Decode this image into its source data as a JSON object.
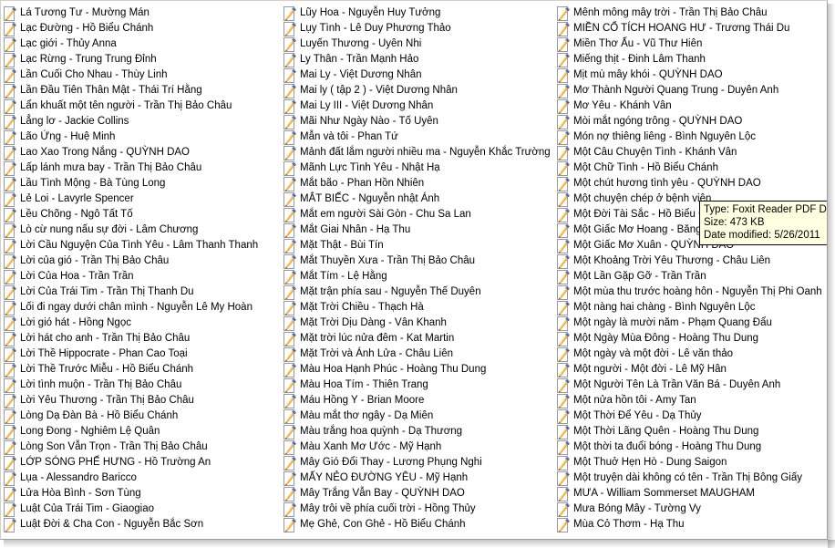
{
  "window": {
    "kind": "file-explorer-list-view",
    "icon_name": "pdf-document-icon",
    "accent": "#ffffe1",
    "border_color": "#9e9e9e",
    "text_color": "#000000"
  },
  "tooltip": {
    "visible": true,
    "type_line": "Type: Foxit Reader PDF Do",
    "size_line": "Size: 473 KB",
    "date_line": "Date modified: 5/26/2011 ",
    "background": "#ffffe1"
  },
  "columns": [
    {
      "name": "column-1",
      "items": [
        "Lá Tương Tư - Mường Mán",
        "Lạc Đường - Hồ Biểu Chánh",
        "Lạc giới - Thủy Anna",
        "Lạc Rừng - Trung Trung Đỉnh",
        "Lần Cuối Cho Nhau - Thùy Linh",
        "Lần Đầu Tiên Thân Mật - Thái Trí Hằng",
        "Lẩn khuất một tên người - Trần Thị Bảo Châu",
        "Lẳng lơ - Jackie Collins",
        "Lão Ứng - Huệ Minh",
        "Lao Xao Trong Nắng - QUỲNH DAO",
        "Lấp lánh mưa bay - Trần Thị Bảo Châu",
        "Lầu Tình Mộng - Bà Tùng Long",
        "Lẻ Loi - Lavyrle Spencer",
        "Lều Chõng - Ngô Tất Tố",
        "Lò cừ nung nấu sự đời - Lâm Chương",
        "Lời Cầu Nguyện Của Tình Yêu - Lâm Thanh Thanh",
        "Lời của gió - Trần Thị Bảo Châu",
        "Lời Của Hoa - Trần Trần",
        "Lời Của Trái Tim - Trần Thị Thanh Du",
        "Lối đi ngay dưới chân mình - Nguyễn Lê My Hoàn",
        "Lời gió hát - Hồng Ngọc",
        "Lời hát cho anh - Trần Thị Bảo Châu",
        "Lời Thề Hippocrate - Phan Cao Toại",
        "Lời Thề Trước Miễu - Hồ Biểu Chánh",
        "Lời tình muộn - Trần Thị Bảo Châu",
        "Lời Yêu Thương - Trần Thị Bảo Châu",
        "Lòng Dạ Đàn Bà - Hồ Biểu Chánh",
        "Long Đong - Nghiêm Lệ Quân",
        "Lòng Son Vẫn Trọn - Trần Thị Bảo Châu",
        "LỚP SÓNG PHẾ HƯNG - Hồ Trường An",
        "Lụa - Alessandro Baricco",
        "Lửa Hòa Bình - Sơn Tùng",
        "Luật Của Trái Tim - Giaogiao",
        "Luật Đời & Cha Con - Nguyễn Bắc Sơn"
      ]
    },
    {
      "name": "column-2",
      "items": [
        "Lũy Hoa - Nguyễn Huy Tưởng",
        "Lụy Tình - Lê Duy Phương Thảo",
        "Luyến Thương - Uyên Nhi",
        "Ly Thân - Trần Mạnh Hảo",
        "Mai Ly - Việt Dương Nhân",
        "Mai ly ( tập 2 ) - Việt Dương Nhân",
        "Mai Ly III - Việt Dương Nhân",
        "Mãi Như Ngày Nào - Tố Uyên",
        "Mẫn và tôi - Phan Tứ",
        "Mảnh đất lắm người nhiều ma - Nguyễn Khắc Trường",
        "Mãnh Lực Tình Yêu - Nhật Hạ",
        "Mắt bão - Phan Hồn Nhiên",
        "MẮT BIẾC - Nguyễn nhật Ánh",
        "Mắt em người Sài Gòn - Chu Sa Lan",
        "Mắt Giai Nhân - Hạ Thu",
        "Mặt Thật - Bùi Tín",
        "Mắt Thuyền Xưa - Trần Thị Bảo Châu",
        "Mắt Tím - Lệ Hằng",
        "Mặt trận phía sau - Nguyễn Thế Duyên",
        "Mặt Trời Chiều - Thạch Hà",
        "Mặt Trời Dịu Dàng - Vân Khanh",
        "Mặt trời lúc nửa đêm - Kat Martin",
        "Mặt Trời và Ánh Lửa - Châu Liên",
        "Màu Hoa Hạnh Phúc - Hoàng Thu Dung",
        "Màu Hoa Tím - Thiên Trang",
        "Máu Hồng Y - Brian Moore",
        "Màu mắt thơ ngây - Dạ Miên",
        "Màu trắng hoa quỳnh - Dạ Thương",
        "Màu Xanh Mơ Ước - Mỹ Hạnh",
        "Mây Gió Đổi Thay - Lương Phụng Nghi",
        "MẤY NẺO ĐƯỜNG YÊU - Mỹ Hạnh",
        "Mây Trắng Vẫn Bay - QUỲNH DAO",
        "Mây trôi về phía cuối trời - Hồng Thủy",
        "Mẹ Ghẻ, Con Ghẻ - Hồ Biểu Chánh"
      ]
    },
    {
      "name": "column-3",
      "items": [
        "Mênh mông mây trời - Trần Thị Bảo Châu",
        "MIỀN CỔ TÍCH HOANG HƯ - Trương Thái Du",
        "Miền Thơ Ấu - Vũ Thư Hiên",
        "Miếng thịt - Đinh Lâm Thanh",
        "Mịt mù mây khói - QUỲNH DAO",
        "Mơ Thành Người Quang Trung - Duyên Anh",
        "Mơ Yêu - Khánh Vân",
        "Mòi mắt ngóng trông - QUỲNH DAO",
        "Món nợ thiêng liêng - Bình Nguyên Lộc",
        "Một Câu Chuyện Tình - Khánh Vân",
        "Một Chữ Tình - Hồ Biểu Chánh",
        "Một chút hương tình yêu - QUỲNH DAO",
        "Một chuyện chép ở bệnh viện",
        "Một Đời Tài Sắc - Hồ Biểu Chá",
        "Một Giấc Mơ Hoang - Băng Tu",
        "Một Giấc Mơ Xuân - QUỲNH DAO",
        "Một Khoảng Trời Yêu Thương - Châu Liên",
        "Một Lần Gặp Gỡ - Trần Trần",
        "Một mùa thu trước hoàng hôn - Nguyễn Thị Phi Oanh",
        "Một nàng hai chàng - Bình Nguyên Lộc",
        "Một ngày là mười năm - Phạm Quang Đẩu",
        "Một Ngày Mùa Đông - Hoàng Thu Dung",
        "Một ngày và một đời - Lê văn thảo",
        "Một người - Một đời - Lê Mỹ Hân",
        "Một Người Tên Là Trần Văn Bá - Duyên Anh",
        "Một nửa hồn tôi - Amy Tan",
        "Một Thời Để Yêu - Dạ Thủy",
        "Một Thời Lãng Quên - Hoàng Thu Dung",
        "Một thời ta đuổi bóng - Hoàng Thu Dung",
        "Một Thuở Hẹn Hò - Dung Saigon",
        "Một truyện dài không có tên - Trần Thị Bông Giấy",
        "MƯA - William Sommerset MAUGHAM",
        "Mưa Bóng Mây - Tường Vy",
        "Mùa Cỏ Thơm - Hạ Thu"
      ]
    }
  ]
}
